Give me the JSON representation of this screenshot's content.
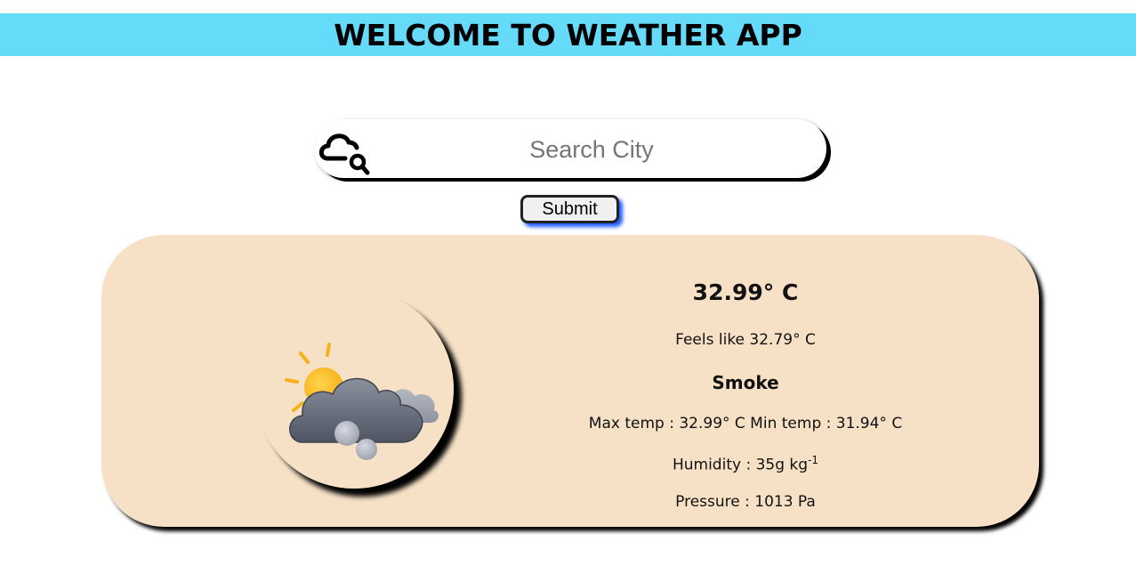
{
  "header": {
    "title": "WELCOME TO WEATHER APP",
    "background_color": "#66daf9"
  },
  "search": {
    "placeholder": "Search City",
    "value": "",
    "icon": "cloud-search-icon"
  },
  "submit": {
    "label": "Submit",
    "shadow_color": "#1f5cff"
  },
  "weather": {
    "card_color": "#f6e1c6",
    "icon": "partly-cloudy-smoke-icon",
    "temperature": "32.99° C",
    "feels_like": "Feels like 32.79° C",
    "condition": "Smoke",
    "min_max": "Max temp : 32.99° C Min temp : 31.94° C",
    "humidity_text": "Humidity : 35g kg",
    "humidity_exponent": "-1",
    "pressure": "Pressure : 1013 Pa"
  }
}
